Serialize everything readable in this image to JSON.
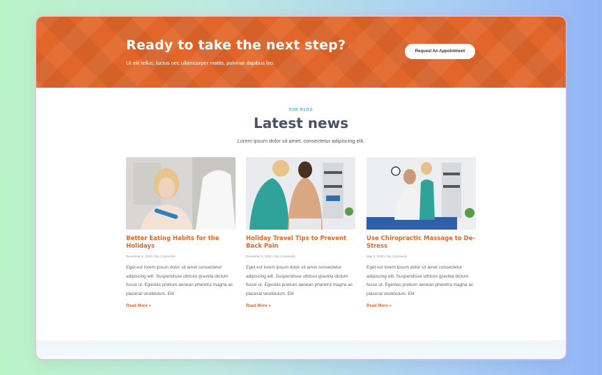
{
  "cta": {
    "title": "Ready to take the next step?",
    "subtitle": "Ut elit tellus, luctus nec ullamcorper mattis, pulvinar dapibus leo.",
    "button": "Request An Appointment"
  },
  "blog": {
    "eyebrow": "OUR BLOG",
    "title": "Latest news",
    "subtitle": "Lorem ipsum dolor sit amet, consectetur adipiscing elit.",
    "posts": [
      {
        "title": "Better Eating Habits for the Holidays",
        "meta": "December 6, 2020 // No Comments",
        "excerpt": "Eget est lorem ipsum dolor sit amet consectetur adipiscing elit. Suspendisse ultrices gravida dictum fusce ut. Egestas pretium aenean pharetra magna ac placerat vestibulum. Elit",
        "more": "Read More »"
      },
      {
        "title": "Holiday Travel Tips to Prevent Back Pain",
        "meta": "December 6, 2020 // No Comments",
        "excerpt": "Eget est lorem ipsum dolor sit amet consectetur adipiscing elit. Suspendisse ultrices gravida dictum fusce ut. Egestas pretium aenean pharetra magna ac placerat vestibulum. Elit",
        "more": "Read More »"
      },
      {
        "title": "Use Chiropractic Massage to De-Stress",
        "meta": "May 3, 2020 // No Comments",
        "excerpt": "Eget est lorem ipsum dolor sit amet consectetur adipiscing elit. Suspendisse ultrices gravida dictum fusce ut. Egestas pretium aenean pharetra magna ac placerat vestibulum. Elit",
        "more": "Read More »"
      }
    ]
  },
  "colors": {
    "accent": "#e2662a",
    "eyebrow": "#2ab3c8",
    "heading": "#4a5068"
  }
}
